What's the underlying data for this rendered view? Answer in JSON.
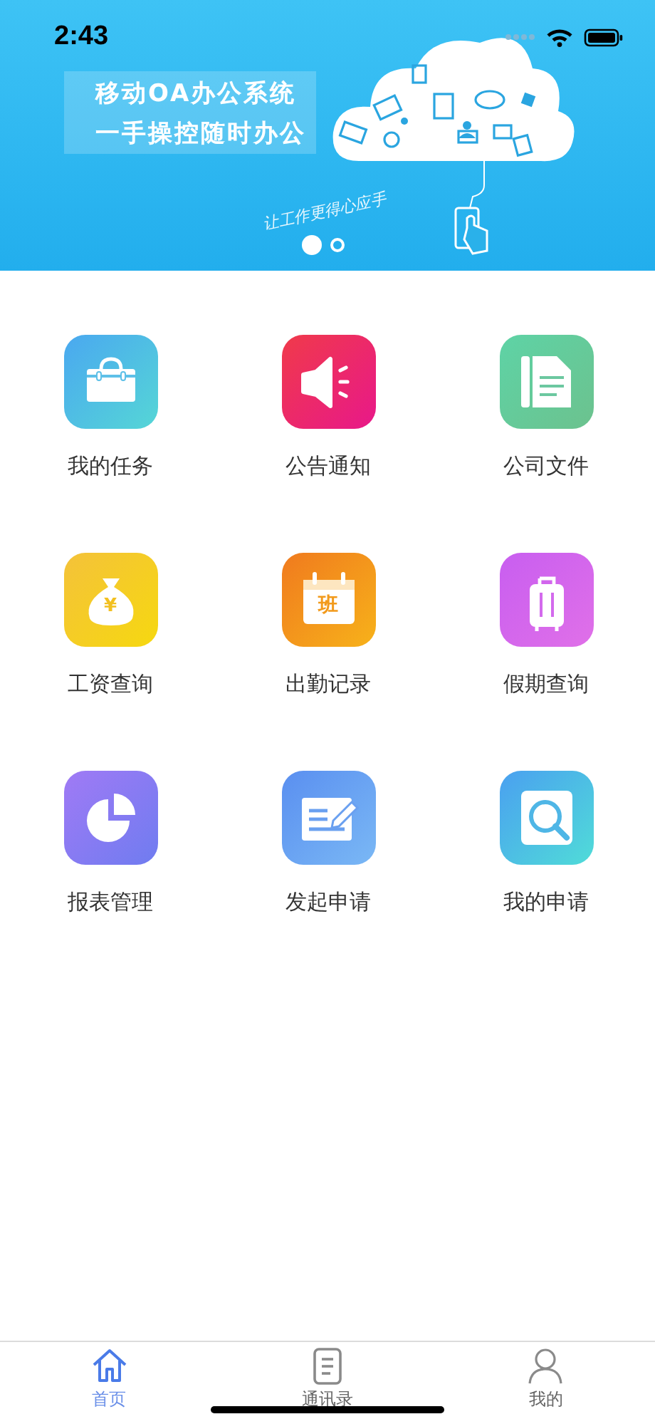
{
  "status_bar": {
    "time": "2:43"
  },
  "banner": {
    "lines": [
      "移动OA办公系统",
      "一手操控随时办公"
    ],
    "slogan": "让工作更得心应手",
    "dots": [
      {
        "selected": true
      },
      {
        "selected": false
      }
    ]
  },
  "features": [
    {
      "label": "我的任务",
      "kind": "briefcase"
    },
    {
      "label": "公告通知",
      "kind": "speaker"
    },
    {
      "label": "公司文件",
      "kind": "document"
    },
    {
      "label": "工资查询",
      "kind": "moneybag",
      "icon_text": "¥"
    },
    {
      "label": "出勤记录",
      "kind": "calendar",
      "icon_text": "班"
    },
    {
      "label": "假期查询",
      "kind": "suitcase"
    },
    {
      "label": "报表管理",
      "kind": "piechart"
    },
    {
      "label": "发起申请",
      "kind": "form"
    },
    {
      "label": "我的申请",
      "kind": "search"
    }
  ],
  "tab_bar": [
    {
      "label": "首页",
      "kind": "home",
      "selected": true
    },
    {
      "label": "通讯录",
      "kind": "contacts",
      "selected": false
    },
    {
      "label": "我的",
      "kind": "person",
      "selected": false
    }
  ]
}
